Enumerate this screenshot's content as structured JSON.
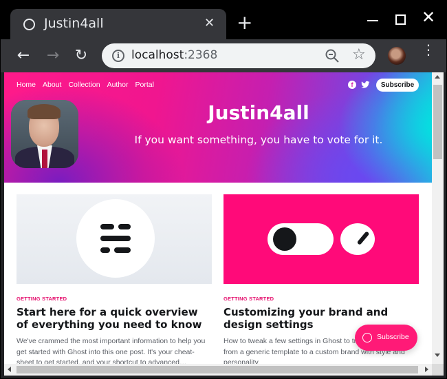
{
  "browser": {
    "tab_title": "Justin4all",
    "tab_close_glyph": "✕",
    "new_tab_glyph": "+",
    "close_window_glyph": "✕",
    "url_host": "localhost",
    "url_port": ":2368",
    "info_glyph": "i",
    "back_glyph": "←",
    "forward_glyph": "→",
    "reload_glyph": "↻",
    "star_glyph": "☆",
    "menu_glyph": "⋮"
  },
  "site": {
    "nav": [
      "Home",
      "About",
      "Collection",
      "Author",
      "Portal"
    ],
    "subscribe_label": "Subscribe",
    "facebook_glyph": "f",
    "twitter_glyph": "🐦",
    "title": "Justin4all",
    "description": "If you want something, you have to vote for it.",
    "accent_color": "#ff1a77"
  },
  "posts": [
    {
      "tag": "GETTING STARTED",
      "title": "Start here for a quick overview of everything you need to know",
      "excerpt": "We've crammed the most important information to help you get started with Ghost into this one post. It's your cheat-sheet to get started, and your shortcut to advanced…"
    },
    {
      "tag": "GETTING STARTED",
      "title": "Customizing your brand and design settings",
      "excerpt": "How to tweak a few settings in Ghost to transform your site from a generic template to a custom brand with style and personality."
    }
  ],
  "portal": {
    "label": "Subscribe"
  }
}
